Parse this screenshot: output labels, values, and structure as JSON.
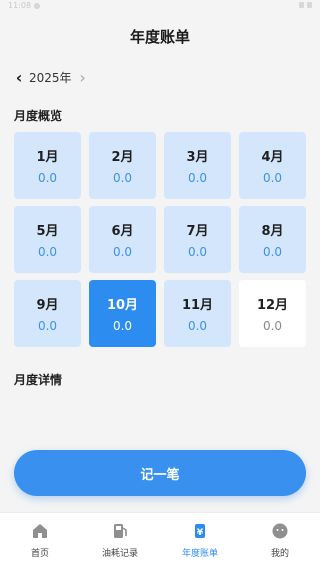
{
  "status_bar": {
    "time": "11:08"
  },
  "header": {
    "title": "年度账单"
  },
  "year_nav": {
    "year": "2025年"
  },
  "overview": {
    "title": "月度概览",
    "months": [
      {
        "label": "1月",
        "amount": "0.0",
        "state": "normal"
      },
      {
        "label": "2月",
        "amount": "0.0",
        "state": "normal"
      },
      {
        "label": "3月",
        "amount": "0.0",
        "state": "normal"
      },
      {
        "label": "4月",
        "amount": "0.0",
        "state": "normal"
      },
      {
        "label": "5月",
        "amount": "0.0",
        "state": "normal"
      },
      {
        "label": "6月",
        "amount": "0.0",
        "state": "normal"
      },
      {
        "label": "7月",
        "amount": "0.0",
        "state": "normal"
      },
      {
        "label": "8月",
        "amount": "0.0",
        "state": "normal"
      },
      {
        "label": "9月",
        "amount": "0.0",
        "state": "normal"
      },
      {
        "label": "10月",
        "amount": "0.0",
        "state": "selected"
      },
      {
        "label": "11月",
        "amount": "0.0",
        "state": "normal"
      },
      {
        "label": "12月",
        "amount": "0.0",
        "state": "future"
      }
    ]
  },
  "details": {
    "title": "月度详情"
  },
  "record_button": {
    "label": "记一笔"
  },
  "tabbar": {
    "items": [
      {
        "label": "首页",
        "icon": "home-icon"
      },
      {
        "label": "油耗记录",
        "icon": "fuel-pump-icon"
      },
      {
        "label": "年度账单",
        "icon": "bill-icon"
      },
      {
        "label": "我的",
        "icon": "profile-icon"
      }
    ],
    "active_index": 2
  },
  "colors": {
    "accent": "#2d8cf0",
    "cell_bg": "#d3e6fc",
    "amount_text": "#3f92e6",
    "inactive_icon": "#8f8f8f"
  }
}
